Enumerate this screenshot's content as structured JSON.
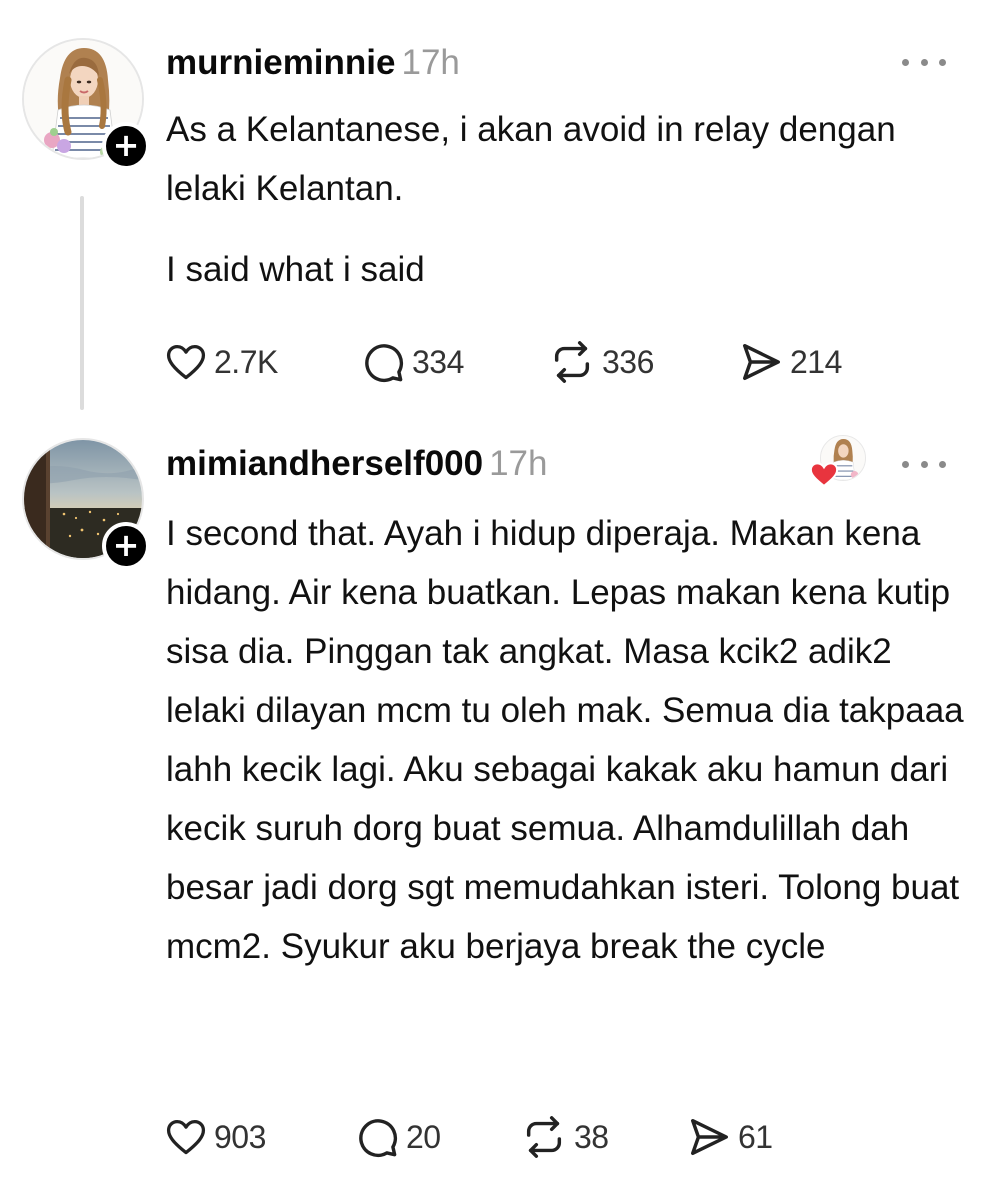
{
  "posts": [
    {
      "username": "murnieminnie",
      "timestamp": "17h",
      "avatar_icon": "illustrated-woman-avatar",
      "paragraphs": [
        "As a Kelantanese, i akan avoid in relay dengan lelaki Kelantan.",
        "I said what i said"
      ],
      "stats": {
        "likes": "2.7K",
        "replies": "334",
        "reposts": "336",
        "shares": "214"
      }
    },
    {
      "username": "mimiandherself000",
      "timestamp": "17h",
      "avatar_icon": "city-skyline-avatar",
      "liked_by_icon": "liked-by-author-heart",
      "paragraphs": [
        "I second that. Ayah i hidup diperaja. Makan kena hidang. Air kena buatkan. Lepas makan kena kutip sisa dia. Pinggan tak angkat. Masa kcik2 adik2 lelaki dilayan mcm tu oleh mak. Semua dia takpaaa lahh kecik lagi. Aku sebagai kakak aku hamun dari kecik suruh dorg buat semua. Alhamdulillah dah besar jadi dorg sgt memudahkan isteri. Tolong buat mcm2. Syukur aku berjaya break the cycle"
      ],
      "stats": {
        "likes": "903",
        "replies": "20",
        "reposts": "38",
        "shares": "61"
      }
    }
  ],
  "colors": {
    "text": "#111111",
    "muted": "#9a9a9a",
    "thread_line": "#dcdcdc",
    "heart": "#e8343e",
    "follow_button": "#000000"
  }
}
